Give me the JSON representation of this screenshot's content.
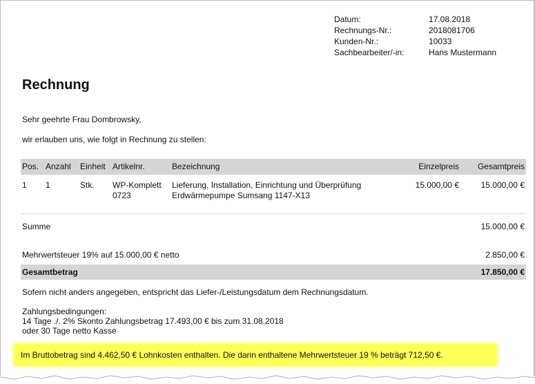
{
  "meta": {
    "datum_label": "Datum:",
    "datum_value": "17.08.2018",
    "rechnungsnr_label": "Rechnungs-Nr.:",
    "rechnungsnr_value": "2018081706",
    "kundennr_label": "Kunden-Nr.:",
    "kundennr_value": "10033",
    "sachbearbeiter_label": "Sachbearbeiter/-in:",
    "sachbearbeiter_value": "Hans Mustermann"
  },
  "title": "Rechnung",
  "greeting": "Sehr geehrte Frau Dombrowsky,",
  "intro": "wir erlauben uns, wie folgt in Rechnung zu stellen:",
  "table": {
    "headers": {
      "pos": "Pos.",
      "anzahl": "Anzahl",
      "einheit": "Einheit",
      "artikelnr": "Artikelnr.",
      "bezeichnung": "Bezeichnung",
      "einzelpreis": "Einzelpreis",
      "gesamtpreis": "Gesamtpreis"
    },
    "rows": [
      {
        "pos": "1",
        "anzahl": "1",
        "einheit": "Stk.",
        "artikelnr_line1": "WP-Komplett",
        "artikelnr_line2": "0723",
        "bezeichnung_line1": "Lieferung, Installation, Einrichtung und Überprüfung",
        "bezeichnung_line2": "Erdwärmepumpe Sumsang 1147-X13",
        "einzelpreis": "15.000,00 €",
        "gesamtpreis": "15.000,00 €"
      }
    ]
  },
  "summe": {
    "label": "Summe",
    "value": "15.000,00 €"
  },
  "mwst": {
    "label": "Mehrwertsteuer 19% auf 15.000,00 € netto",
    "value": "2.850,00 €"
  },
  "gesamt": {
    "label": "Gesamtbetrag",
    "value": "17.850,00 €"
  },
  "note": "Sofern nicht anders angegeben, entspricht das Liefer-/Leistungsdatum dem Rechnungsdatum.",
  "payment": {
    "line1": "Zahlungsbedingungen:",
    "line2": "14 Tage ./. 2% Skonto Zahlungsbetrag 17.493,00 € bis zum 31.08.2018",
    "line3": "oder 30 Tage netto Kasse"
  },
  "highlight": "Im Bruttobetrag sind 4.462,50 € Lohnkosten enthalten. Die darin enthaltene Mehrwertsteuer 19 % beträgt 712,50 €.",
  "colors": {
    "highlight": "#ffff5a",
    "table_header": "#d5d5d5"
  }
}
